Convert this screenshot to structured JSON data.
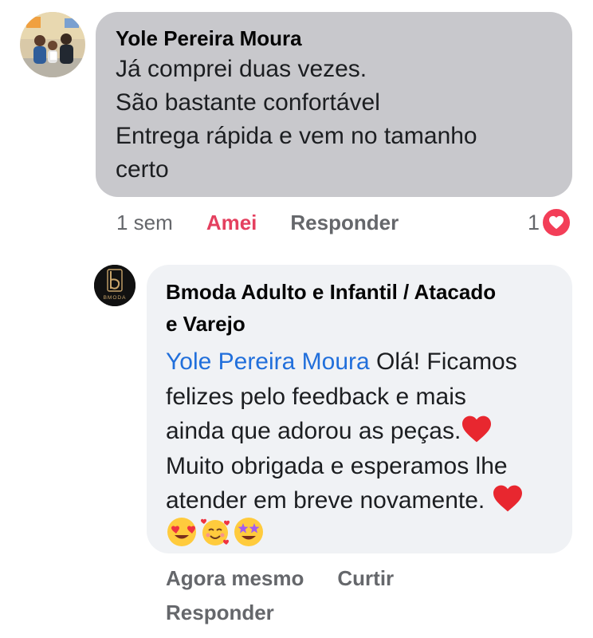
{
  "comment": {
    "author": "Yole Pereira Moura",
    "lines": [
      "Já comprei duas vezes.",
      "São  bastante confortável",
      "Entrega rápida e vem no tamanho",
      "certo"
    ],
    "time": "1 sem",
    "reaction_label": "Amei",
    "reply_label": "Responder",
    "reaction_count": "1",
    "reaction_icon": "heart-icon",
    "reaction_color": "#f33e58"
  },
  "reply": {
    "author_line1": "Bmoda Adulto e Infantil / Atacado",
    "author_line2": "e Varejo",
    "avatar_logo_text": "BMODA",
    "mention": "Yole Pereira Moura",
    "lines": [
      " Olá! Ficamos",
      "felizes pelo feedback e mais",
      "ainda que adorou as peças.",
      "Muito obrigada e esperamos lhe",
      "atender em breve novamente. "
    ],
    "emojis": [
      "heart-eyes-emoji",
      "smiling-face-with-hearts-emoji",
      "star-struck-emoji"
    ],
    "time": "Agora mesmo",
    "like_label": "Curtir",
    "reply_label": "Responder"
  },
  "colors": {
    "mention": "#216fdb",
    "love_reaction": "#e4405f",
    "bubble_received": "#c8c8cc",
    "bubble_reply": "#f0f2f5"
  }
}
